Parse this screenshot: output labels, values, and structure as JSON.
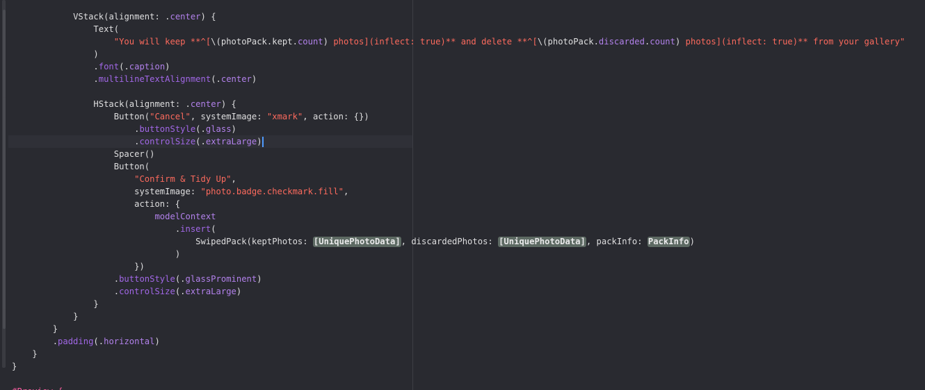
{
  "editor": {
    "lines": [
      {
        "indent": "            ",
        "segments": [
          {
            "t": "VStack",
            "c": "type"
          },
          {
            "t": "(",
            "c": "plain"
          },
          {
            "t": "alignment",
            "c": "plain"
          },
          {
            "t": ": .",
            "c": "plain"
          },
          {
            "t": "center",
            "c": "prop"
          },
          {
            "t": ") {",
            "c": "plain"
          }
        ]
      },
      {
        "indent": "                ",
        "segments": [
          {
            "t": "Text",
            "c": "type"
          },
          {
            "t": "(",
            "c": "plain"
          }
        ]
      },
      {
        "indent": "                    ",
        "segments": [
          {
            "t": "\"You will keep **^[",
            "c": "str"
          },
          {
            "t": "\\(",
            "c": "plain"
          },
          {
            "t": "photoPack",
            "c": "plain"
          },
          {
            "t": ".",
            "c": "plain"
          },
          {
            "t": "kept",
            "c": "plain"
          },
          {
            "t": ".",
            "c": "plain"
          },
          {
            "t": "count",
            "c": "prop"
          },
          {
            "t": ")",
            "c": "plain"
          },
          {
            "t": " photos](inflect: true)** and delete **^[",
            "c": "str"
          },
          {
            "t": "\\(",
            "c": "plain"
          },
          {
            "t": "photoPack",
            "c": "plain"
          },
          {
            "t": ".",
            "c": "plain"
          },
          {
            "t": "discarded",
            "c": "prop"
          },
          {
            "t": ".",
            "c": "plain"
          },
          {
            "t": "count",
            "c": "prop"
          },
          {
            "t": ")",
            "c": "plain"
          },
          {
            "t": " photos](inflect: true)** from your gallery\"",
            "c": "str"
          }
        ]
      },
      {
        "indent": "                ",
        "segments": [
          {
            "t": ")",
            "c": "plain"
          }
        ]
      },
      {
        "indent": "                ",
        "segments": [
          {
            "t": ".",
            "c": "plain"
          },
          {
            "t": "font",
            "c": "fn"
          },
          {
            "t": "(.",
            "c": "plain"
          },
          {
            "t": "caption",
            "c": "prop"
          },
          {
            "t": ")",
            "c": "plain"
          }
        ]
      },
      {
        "indent": "                ",
        "segments": [
          {
            "t": ".",
            "c": "plain"
          },
          {
            "t": "multilineTextAlignment",
            "c": "fn"
          },
          {
            "t": "(.",
            "c": "plain"
          },
          {
            "t": "center",
            "c": "prop"
          },
          {
            "t": ")",
            "c": "plain"
          }
        ]
      },
      {
        "indent": "",
        "segments": []
      },
      {
        "indent": "                ",
        "segments": [
          {
            "t": "HStack",
            "c": "type"
          },
          {
            "t": "(",
            "c": "plain"
          },
          {
            "t": "alignment",
            "c": "plain"
          },
          {
            "t": ": .",
            "c": "plain"
          },
          {
            "t": "center",
            "c": "prop"
          },
          {
            "t": ") {",
            "c": "plain"
          }
        ]
      },
      {
        "indent": "                    ",
        "segments": [
          {
            "t": "Button",
            "c": "type"
          },
          {
            "t": "(",
            "c": "plain"
          },
          {
            "t": "\"Cancel\"",
            "c": "str"
          },
          {
            "t": ", systemImage: ",
            "c": "plain"
          },
          {
            "t": "\"xmark\"",
            "c": "str"
          },
          {
            "t": ", action: {})",
            "c": "plain"
          }
        ]
      },
      {
        "indent": "                        ",
        "segments": [
          {
            "t": ".",
            "c": "plain"
          },
          {
            "t": "buttonStyle",
            "c": "fn"
          },
          {
            "t": "(.",
            "c": "plain"
          },
          {
            "t": "glass",
            "c": "prop"
          },
          {
            "t": ")",
            "c": "plain"
          }
        ]
      },
      {
        "indent": "                        ",
        "caret": true,
        "segments": [
          {
            "t": ".",
            "c": "plain"
          },
          {
            "t": "controlSize",
            "c": "fn"
          },
          {
            "t": "(.",
            "c": "plain"
          },
          {
            "t": "extraLarge",
            "c": "prop"
          },
          {
            "t": ")",
            "c": "plain"
          }
        ]
      },
      {
        "indent": "                    ",
        "segments": [
          {
            "t": "Spacer",
            "c": "type"
          },
          {
            "t": "()",
            "c": "plain"
          }
        ]
      },
      {
        "indent": "                    ",
        "segments": [
          {
            "t": "Button",
            "c": "type"
          },
          {
            "t": "(",
            "c": "plain"
          }
        ]
      },
      {
        "indent": "                        ",
        "segments": [
          {
            "t": "\"Confirm & Tidy Up\"",
            "c": "str"
          },
          {
            "t": ",",
            "c": "plain"
          }
        ]
      },
      {
        "indent": "                        ",
        "segments": [
          {
            "t": "systemImage: ",
            "c": "plain"
          },
          {
            "t": "\"photo.badge.checkmark.fill\"",
            "c": "str"
          },
          {
            "t": ",",
            "c": "plain"
          }
        ]
      },
      {
        "indent": "                        ",
        "segments": [
          {
            "t": "action: {",
            "c": "plain"
          }
        ]
      },
      {
        "indent": "                            ",
        "segments": [
          {
            "t": "modelContext",
            "c": "prop"
          }
        ]
      },
      {
        "indent": "                                ",
        "segments": [
          {
            "t": ".",
            "c": "plain"
          },
          {
            "t": "insert",
            "c": "fn"
          },
          {
            "t": "(",
            "c": "plain"
          }
        ]
      },
      {
        "indent": "                                    ",
        "segments": [
          {
            "t": "SwipedPack(keptPhotos: ",
            "c": "plain"
          },
          {
            "t": "[UniquePhotoData]",
            "c": "ph"
          },
          {
            "t": ", discardedPhotos: ",
            "c": "plain"
          },
          {
            "t": "[UniquePhotoData]",
            "c": "ph"
          },
          {
            "t": ", packInfo: ",
            "c": "plain"
          },
          {
            "t": "PackInfo",
            "c": "ph"
          },
          {
            "t": ")",
            "c": "plain"
          }
        ]
      },
      {
        "indent": "                                ",
        "segments": [
          {
            "t": ")",
            "c": "plain"
          }
        ]
      },
      {
        "indent": "                        ",
        "segments": [
          {
            "t": "})",
            "c": "plain"
          }
        ]
      },
      {
        "indent": "                    ",
        "segments": [
          {
            "t": ".",
            "c": "plain"
          },
          {
            "t": "buttonStyle",
            "c": "fn"
          },
          {
            "t": "(.",
            "c": "plain"
          },
          {
            "t": "glassProminent",
            "c": "prop"
          },
          {
            "t": ")",
            "c": "plain"
          }
        ]
      },
      {
        "indent": "                    ",
        "segments": [
          {
            "t": ".",
            "c": "plain"
          },
          {
            "t": "controlSize",
            "c": "fn"
          },
          {
            "t": "(.",
            "c": "plain"
          },
          {
            "t": "extraLarge",
            "c": "prop"
          },
          {
            "t": ")",
            "c": "plain"
          }
        ]
      },
      {
        "indent": "                ",
        "segments": [
          {
            "t": "}",
            "c": "plain"
          }
        ]
      },
      {
        "indent": "            ",
        "segments": [
          {
            "t": "}",
            "c": "plain"
          }
        ]
      },
      {
        "indent": "        ",
        "segments": [
          {
            "t": "}",
            "c": "plain"
          }
        ]
      },
      {
        "indent": "        ",
        "segments": [
          {
            "t": ".",
            "c": "plain"
          },
          {
            "t": "padding",
            "c": "fn"
          },
          {
            "t": "(.",
            "c": "plain"
          },
          {
            "t": "horizontal",
            "c": "prop"
          },
          {
            "t": ")",
            "c": "plain"
          }
        ]
      },
      {
        "indent": "    ",
        "segments": [
          {
            "t": "}",
            "c": "plain"
          }
        ]
      },
      {
        "indent": "",
        "segments": [
          {
            "t": "}",
            "c": "plain"
          }
        ]
      },
      {
        "indent": "",
        "segments": []
      },
      {
        "indent": "",
        "segments": [
          {
            "t": "#Preview {",
            "c": "kw"
          }
        ]
      }
    ]
  }
}
